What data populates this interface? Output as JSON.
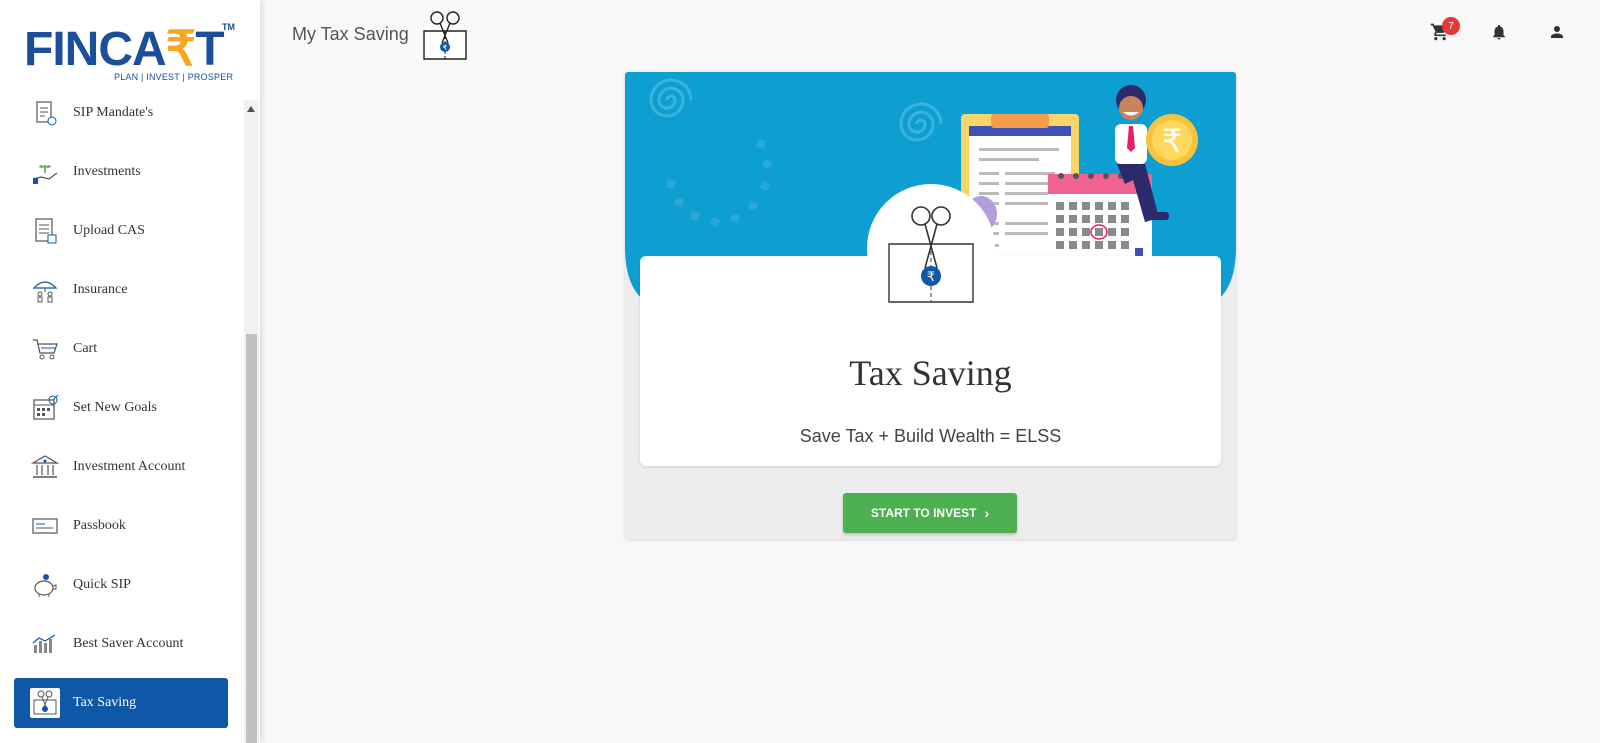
{
  "brand": {
    "name_main": "FINCA",
    "name_accent": "₹",
    "name_end": "T",
    "tm": "TM",
    "tagline": "PLAN | INVEST | PROSPER",
    "primary_color": "#1b4f9c",
    "accent_color": "#f5a623"
  },
  "sidebar": {
    "items": [
      {
        "label": "SIP Mandate's",
        "icon": "clipboard-icon"
      },
      {
        "label": "Investments",
        "icon": "hand-plant-icon"
      },
      {
        "label": "Upload CAS",
        "icon": "document-icon"
      },
      {
        "label": "Insurance",
        "icon": "umbrella-family-icon"
      },
      {
        "label": "Cart",
        "icon": "cart-icon"
      },
      {
        "label": "Set New Goals",
        "icon": "calendar-goal-icon"
      },
      {
        "label": "Investment Account",
        "icon": "bank-icon"
      },
      {
        "label": "Passbook",
        "icon": "passbook-icon"
      },
      {
        "label": "Quick SIP",
        "icon": "piggy-bank-icon"
      },
      {
        "label": "Best Saver Account",
        "icon": "chart-icon"
      },
      {
        "label": "Tax Saving",
        "icon": "scissors-money-icon",
        "active": true
      }
    ],
    "active_color": "#0f58a8"
  },
  "header": {
    "title": "My Tax Saving",
    "cart_count": "7",
    "cart_icon": "cart-icon",
    "notifications_icon": "bell-icon",
    "profile_icon": "person-icon"
  },
  "card": {
    "title": "Tax Saving",
    "subtitle": "Save Tax + Build Wealth = ELSS",
    "cta_label": "START TO INVEST",
    "cta_icon": "chevron-right-icon",
    "banner_color": "#0d9fd1",
    "cta_color": "#4caf50"
  }
}
